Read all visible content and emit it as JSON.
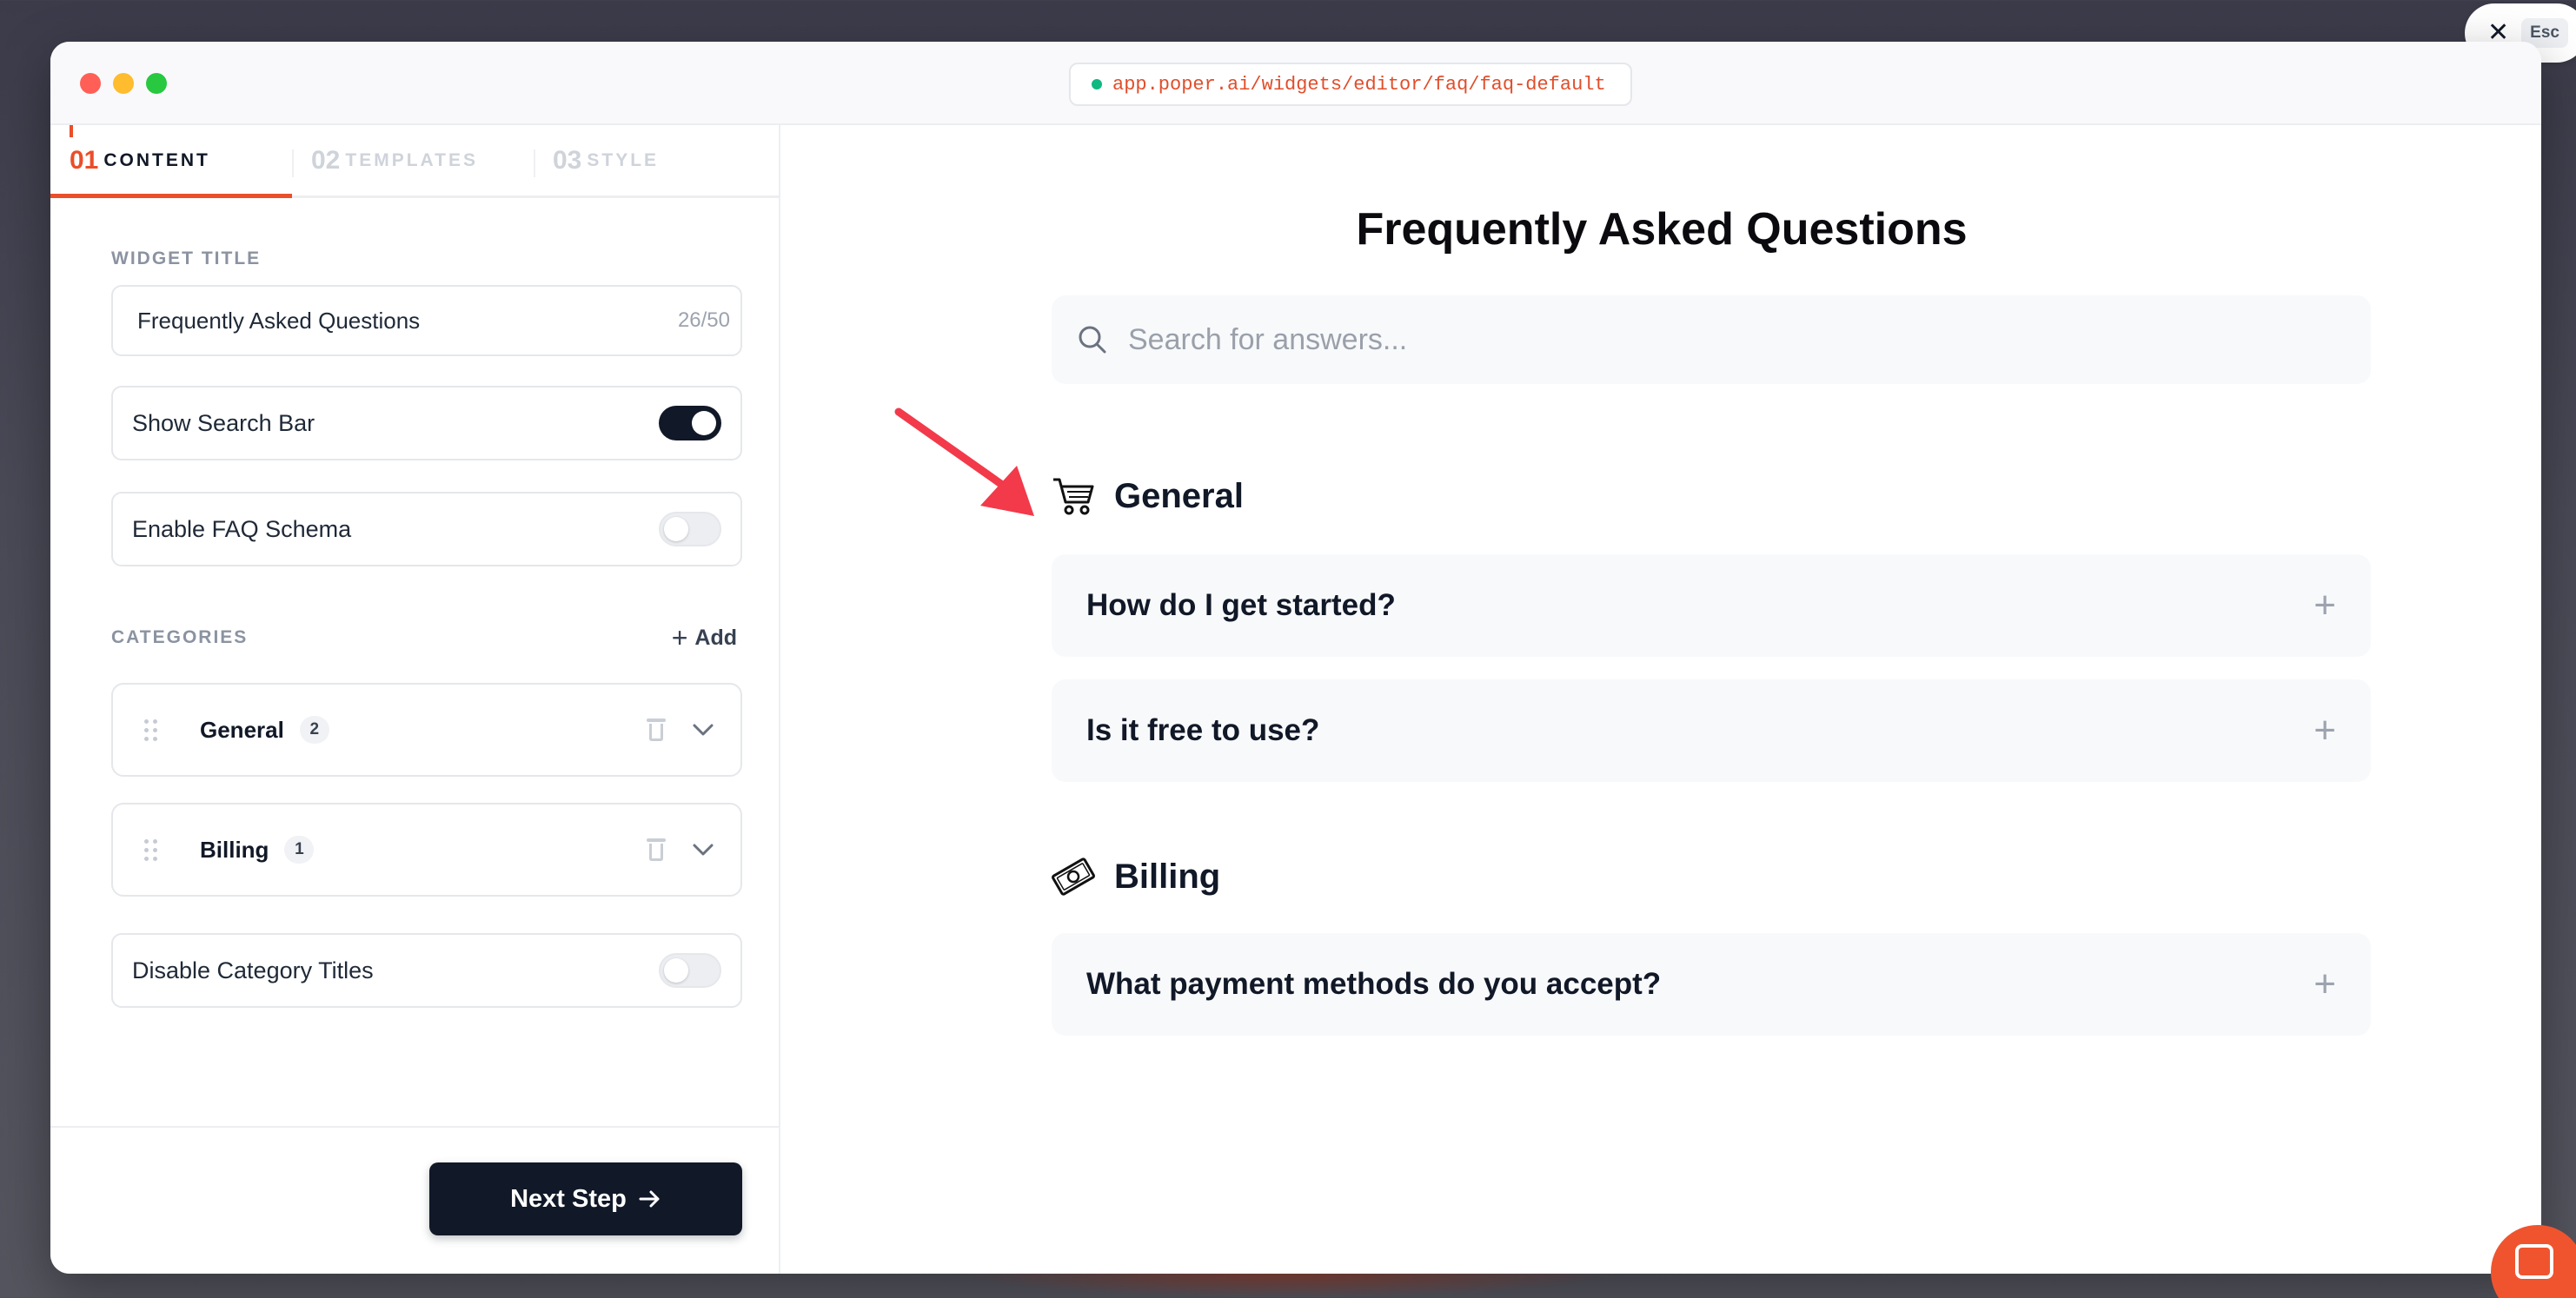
{
  "browser": {
    "url": "app.poper.ai/widgets/editor/faq/faq-default",
    "esc_label": "Esc"
  },
  "tabs": [
    {
      "num": "01",
      "label": "CONTENT",
      "active": true
    },
    {
      "num": "02",
      "label": "TEMPLATES",
      "active": false
    },
    {
      "num": "03",
      "label": "STYLE",
      "active": false
    }
  ],
  "sidebar": {
    "widget_title_label": "WIDGET TITLE",
    "widget_title_value": "Frequently Asked Questions",
    "widget_title_count": "26/50",
    "show_search_bar": {
      "label": "Show Search Bar",
      "on": true
    },
    "enable_faq_schema": {
      "label": "Enable FAQ Schema",
      "on": false
    },
    "categories_label": "CATEGORIES",
    "add_label": "Add",
    "categories": [
      {
        "name": "General",
        "count": "2"
      },
      {
        "name": "Billing",
        "count": "1"
      }
    ],
    "disable_category_titles": {
      "label": "Disable Category Titles",
      "on": false
    },
    "next_step_label": "Next Step"
  },
  "preview": {
    "title": "Frequently Asked Questions",
    "search_placeholder": "Search for answers...",
    "categories": [
      {
        "name": "General",
        "icon": "shopping-cart-icon",
        "questions": [
          "How do I get started?",
          "Is it free to use?"
        ]
      },
      {
        "name": "Billing",
        "icon": "money-bill-icon",
        "questions": [
          "What payment methods do you accept?"
        ]
      }
    ]
  },
  "colors": {
    "accent": "#ea4e2a",
    "primary_dark": "#111827",
    "annotation_arrow": "#f23a4a",
    "chat_launcher": "#f0542e"
  }
}
